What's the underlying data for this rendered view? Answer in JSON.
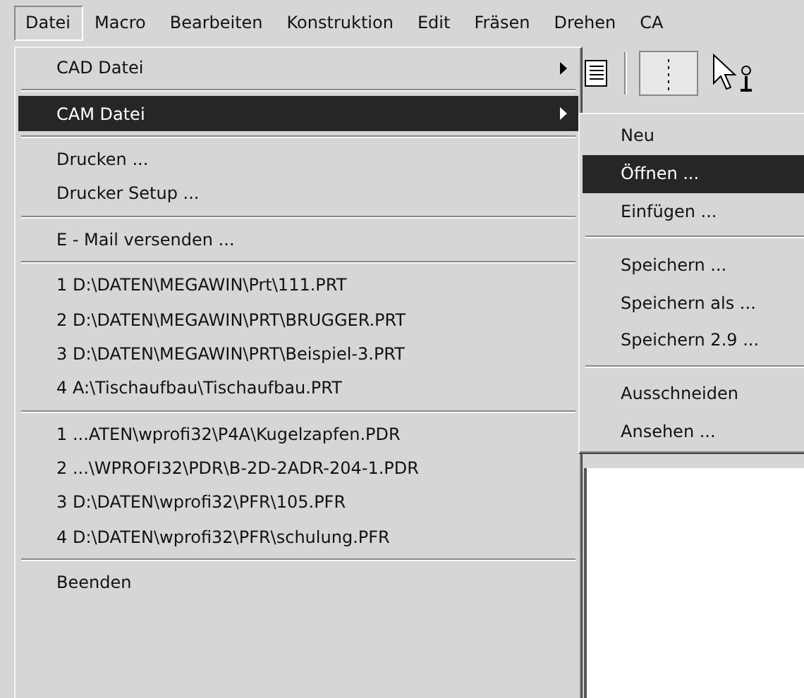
{
  "menubar": {
    "items": [
      {
        "label": "Datei",
        "selected": true
      },
      {
        "label": "Macro",
        "selected": false
      },
      {
        "label": "Bearbeiten",
        "selected": false
      },
      {
        "label": "Konstruktion",
        "selected": false
      },
      {
        "label": "Edit",
        "selected": false
      },
      {
        "label": "Fräsen",
        "selected": false
      },
      {
        "label": "Drehen",
        "selected": false
      },
      {
        "label": "CA",
        "selected": false
      }
    ]
  },
  "menu": {
    "items": [
      {
        "kind": "submenu",
        "label": "CAD Datei",
        "selected": false
      },
      {
        "kind": "separator"
      },
      {
        "kind": "submenu",
        "label": "CAM Datei",
        "selected": true
      },
      {
        "kind": "separator"
      },
      {
        "kind": "item",
        "label": "Drucken ...",
        "selected": false
      },
      {
        "kind": "item",
        "label": "Drucker Setup ...",
        "selected": false
      },
      {
        "kind": "separator"
      },
      {
        "kind": "item",
        "label": "E - Mail versenden ...",
        "selected": false
      },
      {
        "kind": "separator"
      },
      {
        "kind": "item",
        "label": "1 D:\\DATEN\\MEGAWIN\\Prt\\111.PRT",
        "selected": false
      },
      {
        "kind": "item",
        "label": "2 D:\\DATEN\\MEGAWIN\\PRT\\BRUGGER.PRT",
        "selected": false
      },
      {
        "kind": "item",
        "label": "3 D:\\DATEN\\MEGAWIN\\PRT\\Beispiel-3.PRT",
        "selected": false
      },
      {
        "kind": "item",
        "label": "4 A:\\Tischaufbau\\Tischaufbau.PRT",
        "selected": false
      },
      {
        "kind": "separator"
      },
      {
        "kind": "item",
        "label": "1 ...ATEN\\wprofi32\\P4A\\Kugelzapfen.PDR",
        "selected": false
      },
      {
        "kind": "item",
        "label": "2 ...\\WPROFI32\\PDR\\B-2D-2ADR-204-1.PDR",
        "selected": false
      },
      {
        "kind": "item",
        "label": "3 D:\\DATEN\\wprofi32\\PFR\\105.PFR",
        "selected": false
      },
      {
        "kind": "item",
        "label": "4 D:\\DATEN\\wprofi32\\PFR\\schulung.PFR",
        "selected": false
      },
      {
        "kind": "separator"
      },
      {
        "kind": "item",
        "label": "Beenden",
        "selected": false
      }
    ]
  },
  "submenu": {
    "items": [
      {
        "kind": "item",
        "label": "Neu",
        "selected": false
      },
      {
        "kind": "item",
        "label": "Öffnen ...",
        "selected": true
      },
      {
        "kind": "item",
        "label": "Einfügen ...",
        "selected": false
      },
      {
        "kind": "separator"
      },
      {
        "kind": "item",
        "label": "Speichern ...",
        "selected": false
      },
      {
        "kind": "item",
        "label": "Speichern als ...",
        "selected": false
      },
      {
        "kind": "item",
        "label": "Speichern 2.9 ...",
        "selected": false
      },
      {
        "kind": "separator"
      },
      {
        "kind": "item",
        "label": "Ausschneiden",
        "selected": false
      },
      {
        "kind": "item",
        "label": "Ansehen ...",
        "selected": false
      }
    ]
  }
}
